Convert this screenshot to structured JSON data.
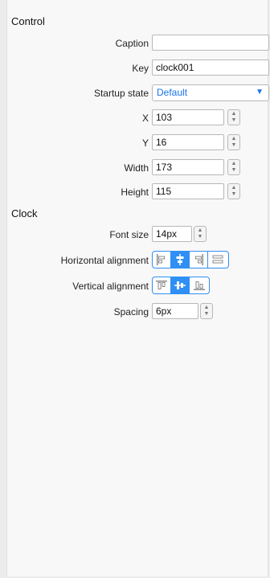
{
  "control_section": {
    "title": "Control",
    "caption": {
      "label": "Caption",
      "value": ""
    },
    "key": {
      "label": "Key",
      "value": "clock001"
    },
    "startup_state": {
      "label": "Startup state",
      "value": "Default"
    },
    "x": {
      "label": "X",
      "value": "103"
    },
    "y": {
      "label": "Y",
      "value": "16"
    },
    "width": {
      "label": "Width",
      "value": "173"
    },
    "height": {
      "label": "Height",
      "value": "115"
    }
  },
  "clock_section": {
    "title": "Clock",
    "font_size": {
      "label": "Font size",
      "value": "14px"
    },
    "horizontal_alignment": {
      "label": "Horizontal alignment",
      "options": [
        "align-left-icon",
        "align-center-icon",
        "align-right-icon",
        "justify-icon"
      ],
      "selected_index": 1
    },
    "vertical_alignment": {
      "label": "Vertical alignment",
      "options": [
        "align-top-icon",
        "align-middle-icon",
        "align-bottom-icon"
      ],
      "selected_index": 1
    },
    "spacing": {
      "label": "Spacing",
      "value": "6px"
    }
  },
  "colors": {
    "accent": "#2f8ff4",
    "select_text": "#1a73e8"
  }
}
